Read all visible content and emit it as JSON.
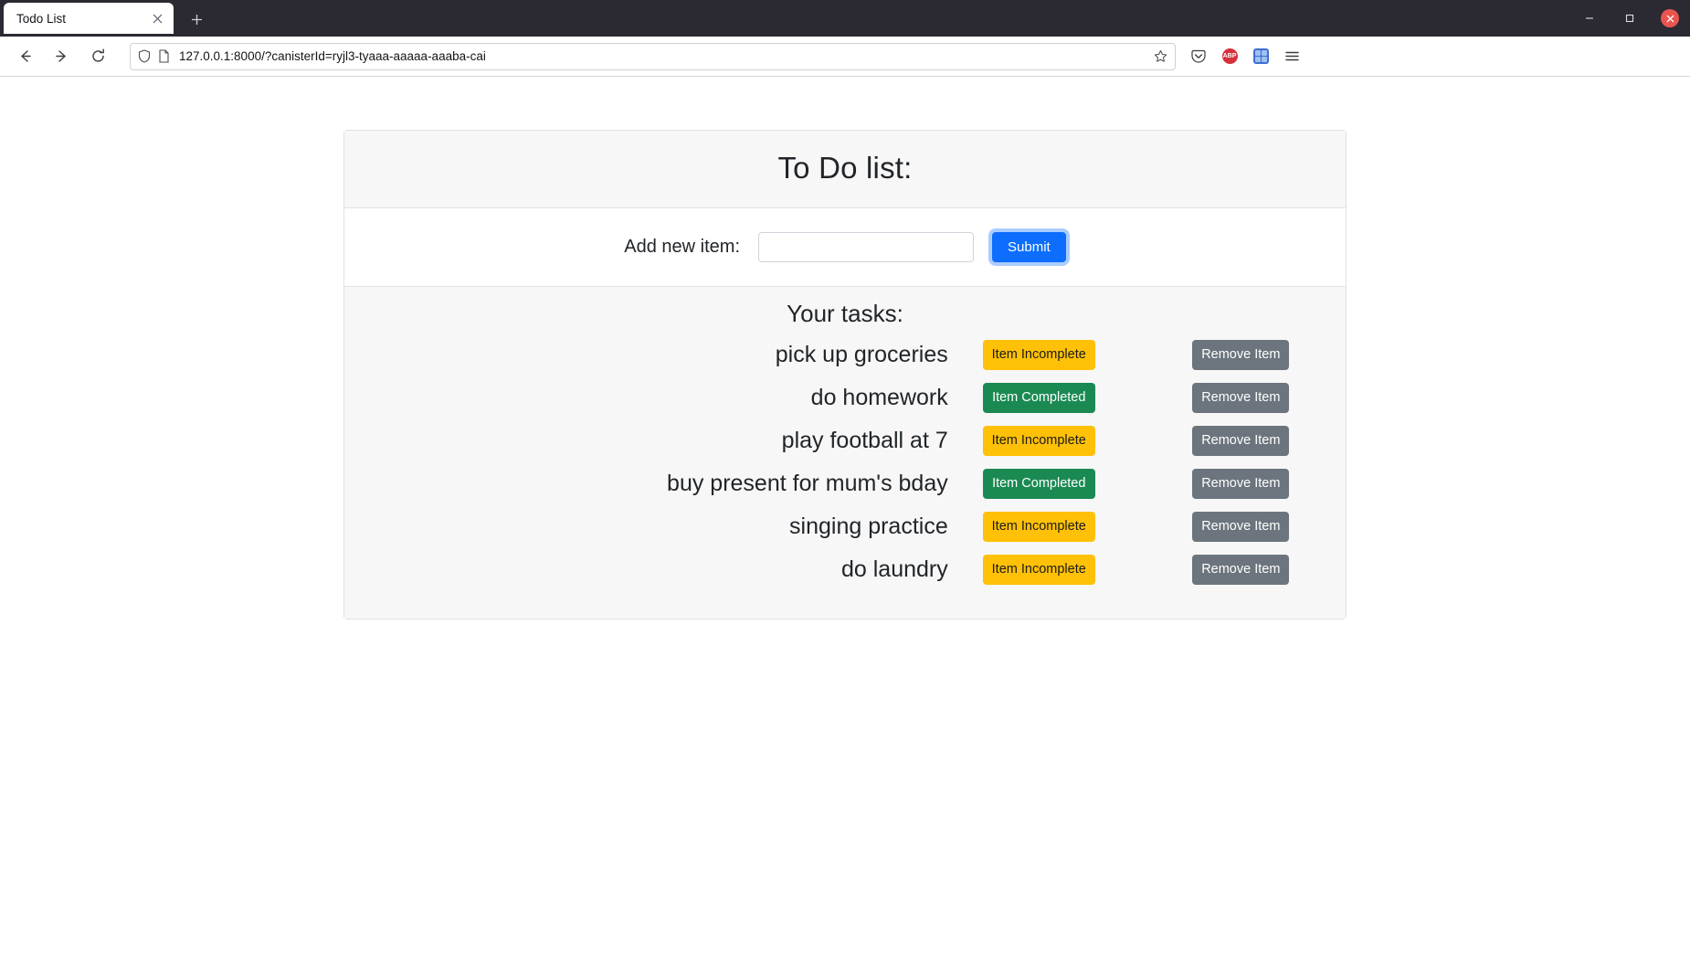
{
  "browser": {
    "tab": {
      "title": "Todo List",
      "close_icon": "close-icon"
    },
    "new_tab_label": "+",
    "window_controls": {
      "minimize": "–",
      "maximize": "□",
      "close": "✕"
    },
    "nav": {
      "back": "←",
      "forward": "→",
      "reload": "↻"
    },
    "url": "127.0.0.1:8000/?canisterId=ryjl3-tyaaa-aaaaa-aaaba-cai",
    "toolbar_icons": [
      "pocket-icon",
      "adblock-icon",
      "extension-icon",
      "menu-icon"
    ],
    "adblock_badge_text": "ABP"
  },
  "page": {
    "card_title": "To Do list:",
    "add_label": "Add new item:",
    "add_input_value": "",
    "add_input_placeholder": "",
    "submit_label": "Submit",
    "tasks_title": "Your tasks:",
    "status_labels": {
      "incomplete": "Item Incomplete",
      "completed": "Item Completed"
    },
    "remove_label": "Remove Item",
    "tasks": [
      {
        "name": "pick up groceries",
        "status": "incomplete",
        "status_label": "Item Incomplete",
        "remove_label": "Remove Item"
      },
      {
        "name": "do homework",
        "status": "completed",
        "status_label": "Item Completed",
        "remove_label": "Remove Item"
      },
      {
        "name": "play football at 7",
        "status": "incomplete",
        "status_label": "Item Incomplete",
        "remove_label": "Remove Item"
      },
      {
        "name": "buy present for mum's bday",
        "status": "completed",
        "status_label": "Item Completed",
        "remove_label": "Remove Item"
      },
      {
        "name": "singing practice",
        "status": "incomplete",
        "status_label": "Item Incomplete",
        "remove_label": "Remove Item"
      },
      {
        "name": "do laundry",
        "status": "incomplete",
        "status_label": "Item Incomplete",
        "remove_label": "Remove Item"
      }
    ]
  },
  "colors": {
    "accent_blue": "#0d6efd",
    "incomplete_amber": "#ffc107",
    "completed_green": "#1b8a52",
    "remove_gray": "#6c757d",
    "chrome_dark": "#2b2a33",
    "panel_gray": "#f7f7f7"
  }
}
